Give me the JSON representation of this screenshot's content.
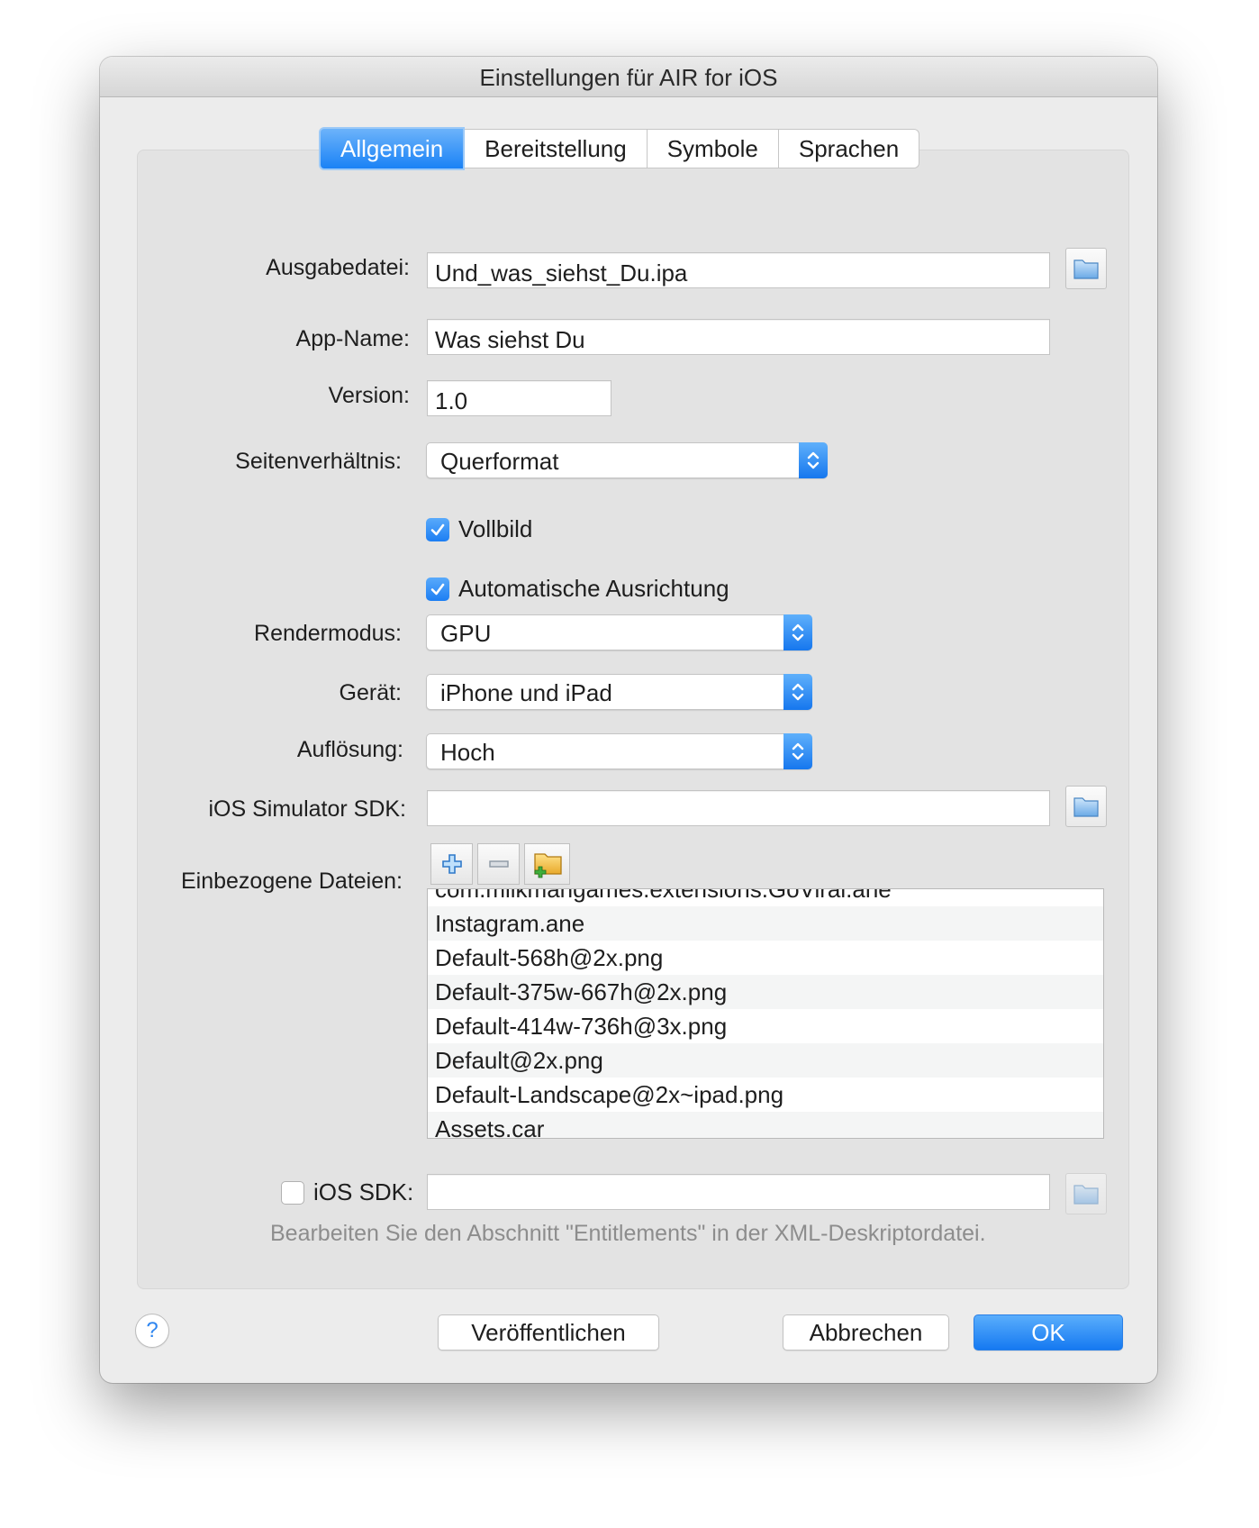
{
  "window": {
    "title": "Einstellungen für AIR for iOS"
  },
  "tabs": [
    {
      "label": "Allgemein",
      "active": true
    },
    {
      "label": "Bereitstellung",
      "active": false
    },
    {
      "label": "Symbole",
      "active": false
    },
    {
      "label": "Sprachen",
      "active": false
    }
  ],
  "form": {
    "output_file": {
      "label": "Ausgabedatei:",
      "value": "Und_was_siehst_Du.ipa"
    },
    "app_name": {
      "label": "App-Name:",
      "value": "Was siehst Du"
    },
    "version": {
      "label": "Version:",
      "value": "1.0"
    },
    "aspect_ratio": {
      "label": "Seitenverhältnis:",
      "value": "Querformat"
    },
    "fullscreen": {
      "label": "Vollbild",
      "checked": true
    },
    "auto_orientation": {
      "label": "Automatische Ausrichtung",
      "checked": true
    },
    "render_mode": {
      "label": "Rendermodus:",
      "value": "GPU"
    },
    "device": {
      "label": "Gerät:",
      "value": "iPhone und iPad"
    },
    "resolution": {
      "label": "Auflösung:",
      "value": "Hoch"
    },
    "ios_simulator_sdk": {
      "label": "iOS Simulator SDK:",
      "value": ""
    },
    "included_files": {
      "label": "Einbezogene Dateien:",
      "partial_row": "com.milkmangames.extensions.GoViral.ane",
      "files": [
        "Instagram.ane",
        "Default-568h@2x.png",
        "Default-375w-667h@2x.png",
        "Default-414w-736h@3x.png",
        "Default@2x.png",
        "Default-Landscape@2x~ipad.png",
        "Assets.car"
      ]
    },
    "ios_sdk": {
      "label": "iOS SDK:",
      "checked": false,
      "value": ""
    },
    "hint": "Bearbeiten Sie den Abschnitt \"Entitlements\" in der XML-Deskriptordatei."
  },
  "buttons": {
    "help": "?",
    "publish": "Veröffentlichen",
    "cancel": "Abbrechen",
    "ok": "OK"
  },
  "icons": {
    "folder": "folder-icon",
    "add": "plus-icon",
    "remove": "minus-icon",
    "add_folder": "add-folder-icon",
    "select_arrows": "chevron-up-down-icon",
    "check": "checkmark-icon"
  },
  "colors": {
    "accent": "#1a82f6",
    "window_bg": "#ececec",
    "group_bg": "#e3e3e3",
    "hint_text": "#8d8d8d"
  }
}
